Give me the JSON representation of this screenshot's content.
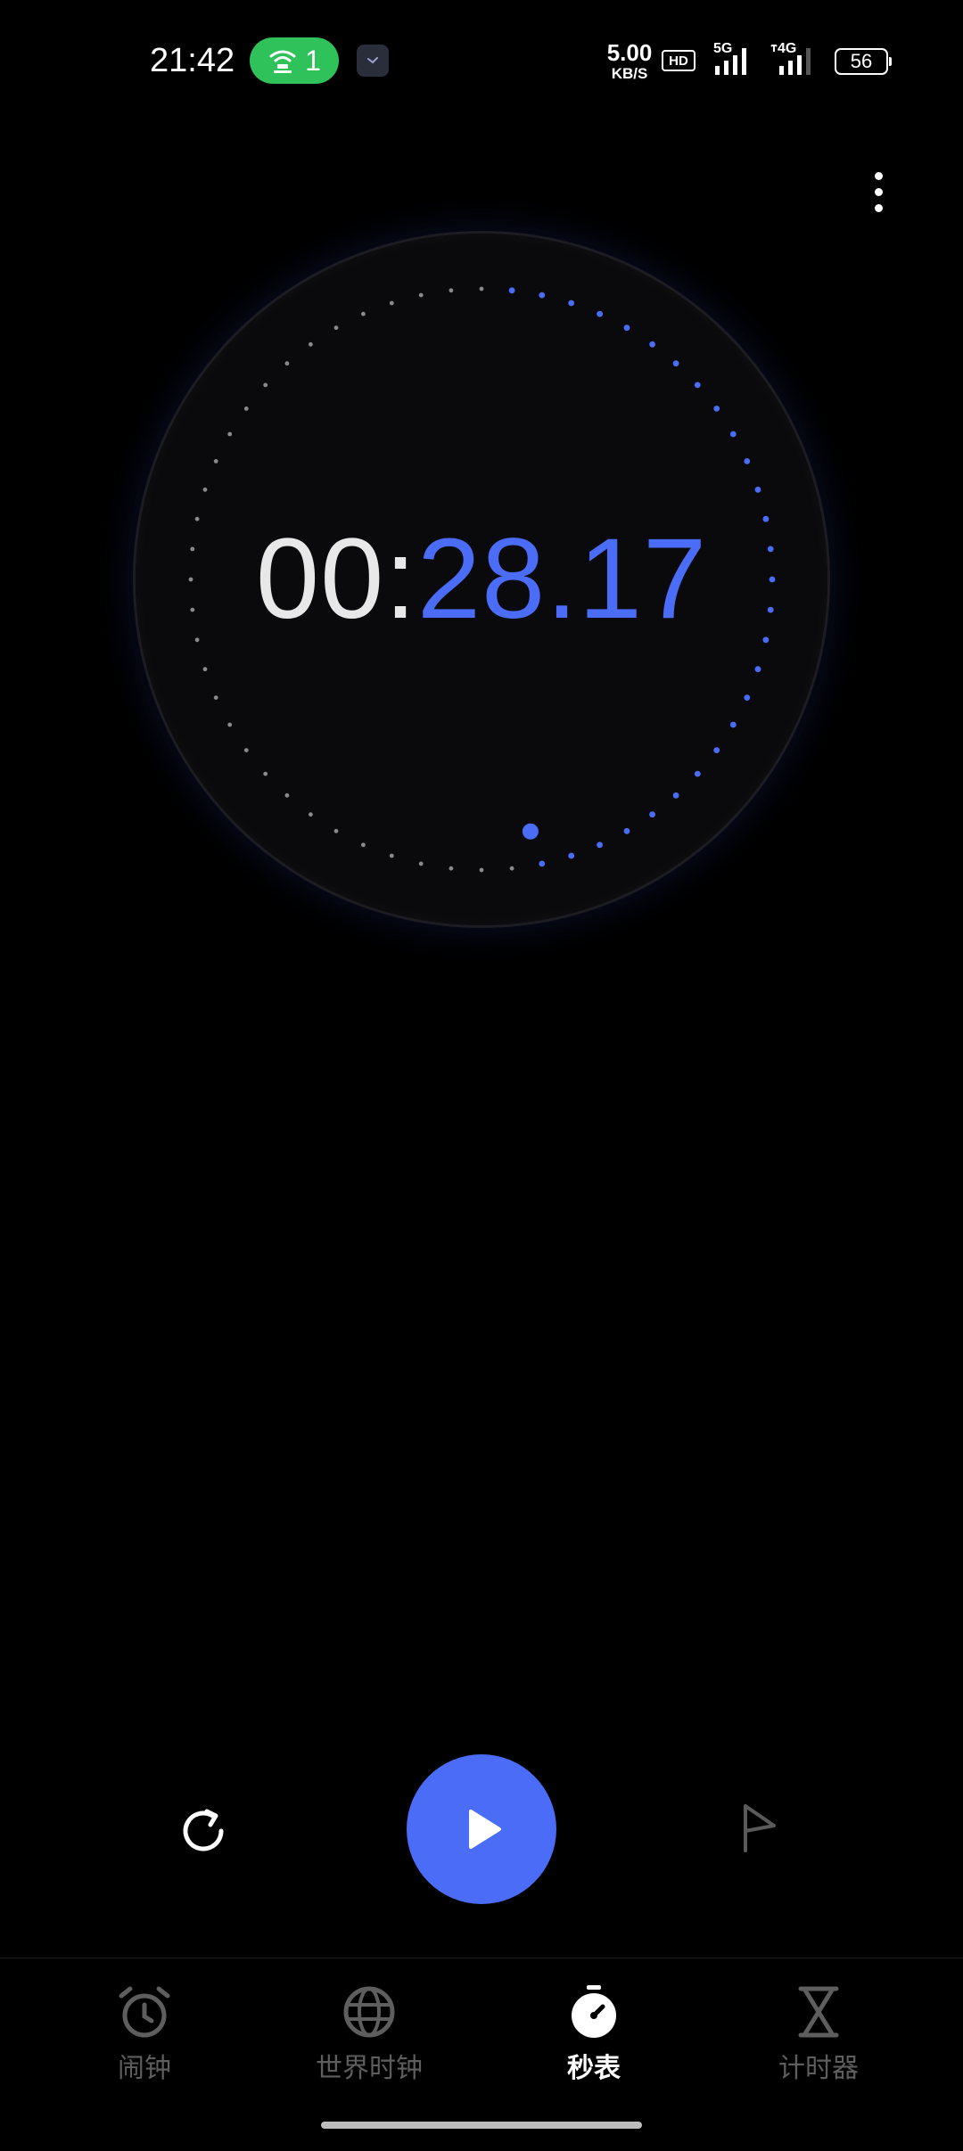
{
  "status_bar": {
    "time": "21:42",
    "hotspot_count": "1",
    "net_speed_value": "5.00",
    "net_speed_unit": "KB/S",
    "hd_label": "HD",
    "signal_1_label": "5G",
    "signal_2_label": "4G",
    "battery_level": "56"
  },
  "stopwatch": {
    "minutes": "00:",
    "seconds": "28.17",
    "progress_fraction": 0.4695
  },
  "controls": {
    "reset_icon": "refresh-icon",
    "play_icon": "play-icon",
    "lap_icon": "flag-icon"
  },
  "bottom_nav": {
    "items": [
      {
        "label": "闹钟",
        "icon": "alarm-clock-icon",
        "active": false
      },
      {
        "label": "世界时钟",
        "icon": "globe-icon",
        "active": false
      },
      {
        "label": "秒表",
        "icon": "stopwatch-icon",
        "active": true
      },
      {
        "label": "计时器",
        "icon": "hourglass-icon",
        "active": false
      }
    ]
  },
  "colors": {
    "accent": "#4a6cf7",
    "background": "#000000",
    "inactive": "#5e5e5e",
    "hotspot": "#2fc25b"
  }
}
